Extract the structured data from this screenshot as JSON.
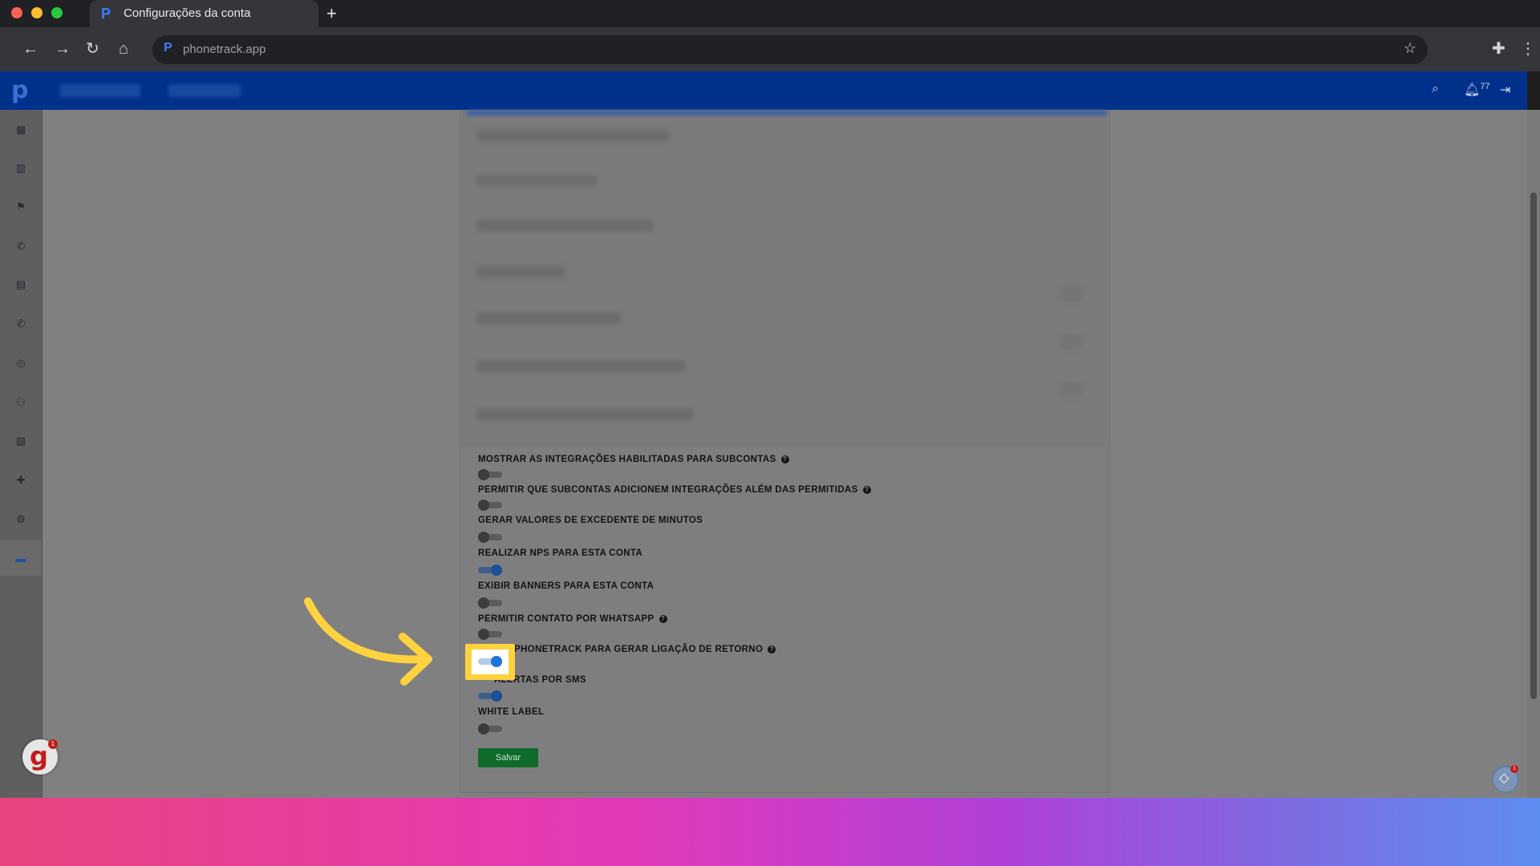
{
  "browser": {
    "tab_title": "Configurações da conta",
    "url": "phonetrack.app"
  },
  "appbar": {
    "notification_count": "77"
  },
  "settings": [
    {
      "label": "MOSTRAR AS INTEGRAÇÕES HABILITADAS PARA SUBCONTAS",
      "has_help": true,
      "enabled": false
    },
    {
      "label": "PERMITIR QUE SUBCONTAS ADICIONEM INTEGRAÇÕES ALÉM DAS PERMITIDAS",
      "has_help": true,
      "enabled": false
    },
    {
      "label": "GERAR VALORES DE EXCEDENTE DE MINUTOS",
      "has_help": false,
      "enabled": false
    },
    {
      "label": "REALIZAR NPS PARA ESTA CONTA",
      "has_help": false,
      "enabled": true
    },
    {
      "label": "EXIBIR BANNERS PARA ESTA CONTA",
      "has_help": false,
      "enabled": false
    },
    {
      "label": "PERMITIR CONTATO POR WHATSAPP",
      "has_help": true,
      "enabled": false
    },
    {
      "label": "PHONETRACK PARA GERAR LIGAÇÃO DE RETORNO",
      "has_help": true,
      "enabled": true
    },
    {
      "label": "ALERTAS POR SMS",
      "has_help": false,
      "enabled": true
    },
    {
      "label": "WHITE LABEL",
      "has_help": false,
      "enabled": false
    }
  ],
  "help_glyph": "?",
  "save_label": "Salvar",
  "widgets": {
    "growth_letter": "g",
    "growth_badge": "1",
    "chat_badge": "1"
  },
  "colors": {
    "appbar": "#00318a",
    "highlight": "#ffd23f",
    "save_button": "#0f6b2b",
    "toggle_on": "#1e74d8"
  }
}
